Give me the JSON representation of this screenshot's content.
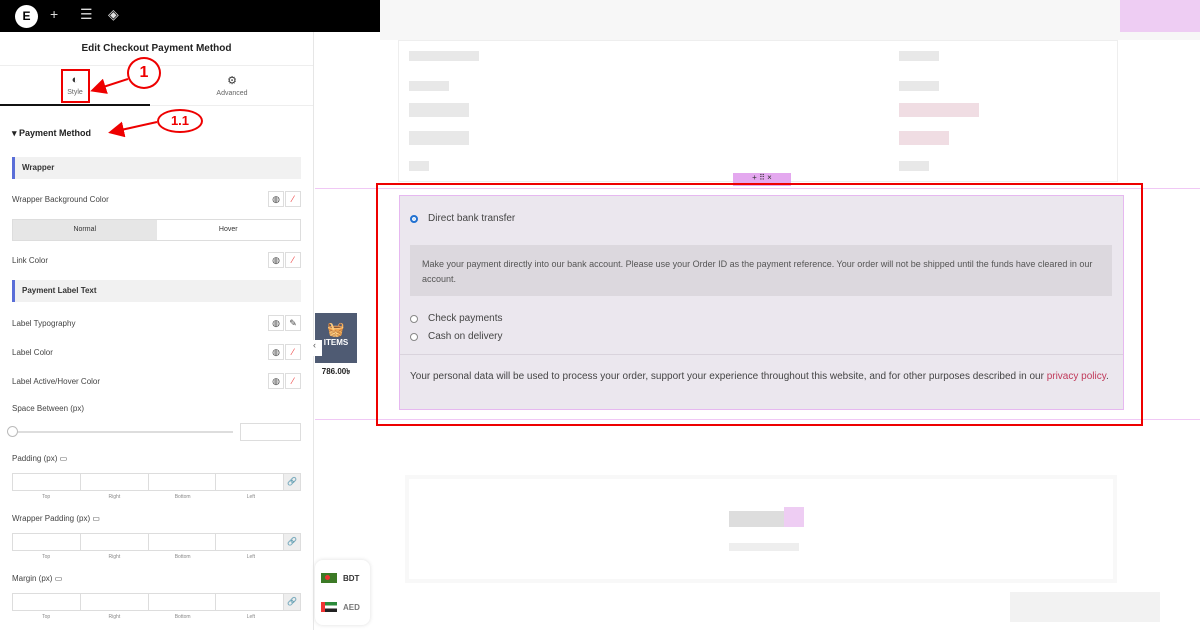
{
  "topbar": {
    "logo": "E",
    "icons": [
      "plus-icon",
      "sliders-icon",
      "layers-icon"
    ]
  },
  "panel": {
    "title": "Edit Checkout Payment Method",
    "tabs": [
      {
        "label": "Style",
        "icon": "contrast-icon"
      },
      {
        "label": "Advanced",
        "icon": "gear-icon"
      }
    ],
    "callouts": [
      "1",
      "1.1"
    ],
    "section": "Payment Method",
    "wrapper_heading": "Wrapper",
    "wrapper_bg": "Wrapper Background Color",
    "states": [
      "Normal",
      "Hover"
    ],
    "link_color": "Link Color",
    "label_heading": "Payment Label Text",
    "label_typography": "Label Typography",
    "label_color": "Label Color",
    "label_active": "Label Active/Hover Color",
    "space_between": "Space Between (px)",
    "padding": "Padding (px)",
    "wrapper_padding": "Wrapper Padding (px)",
    "margin": "Margin (px)",
    "dims": [
      "Top",
      "Right",
      "Bottom",
      "Left"
    ]
  },
  "canvas": {
    "methods": [
      {
        "label": "Direct bank transfer",
        "selected": true
      },
      {
        "label": "Check payments",
        "selected": false
      },
      {
        "label": "Cash on delivery",
        "selected": false
      }
    ],
    "bank_desc": "Make your payment directly into our bank account. Please use your Order ID as the payment reference. Your order will not be shipped until the funds have cleared in our account.",
    "privacy_text": "Your personal data will be used to process your order, support your experience throughout this website, and for other purposes described in our ",
    "privacy_link": "privacy policy",
    "privacy_end": ".",
    "cart_label": "ITEMS",
    "cart_price": "786.00৳",
    "currencies": [
      "BDT",
      "AED"
    ],
    "accent": "#2271d1",
    "link_color": "#c0395a"
  }
}
